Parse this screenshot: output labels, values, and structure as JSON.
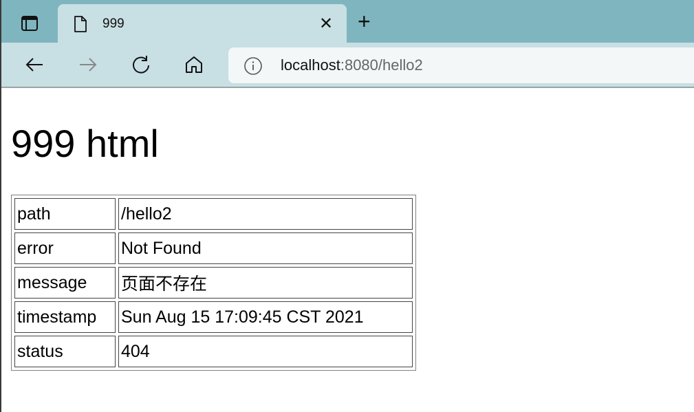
{
  "browser": {
    "tab_title": "999",
    "url_host": "localhost",
    "url_rest": ":8080/hello2",
    "colors": {
      "tabstrip": "#7fb5be",
      "toolbar": "#c8dfe3",
      "address_bar": "#f3f7f8"
    }
  },
  "page": {
    "heading": "999 html",
    "rows": [
      {
        "key": "path",
        "value": "/hello2"
      },
      {
        "key": "error",
        "value": "Not Found"
      },
      {
        "key": "message",
        "value": "页面不存在"
      },
      {
        "key": "timestamp",
        "value": "Sun Aug 15 17:09:45 CST 2021"
      },
      {
        "key": "status",
        "value": "404"
      }
    ]
  }
}
